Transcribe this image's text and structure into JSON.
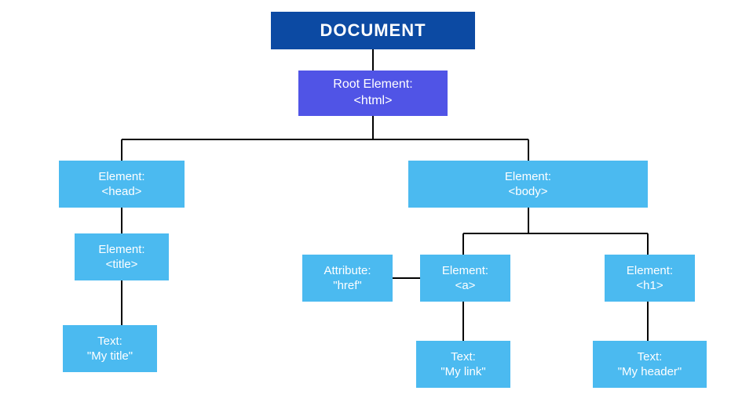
{
  "nodes": {
    "document": {
      "line1": "DOCUMENT",
      "line2": ""
    },
    "root": {
      "line1": "Root Element:",
      "line2": "<html>"
    },
    "head": {
      "line1": "Element:",
      "line2": "<head>"
    },
    "body": {
      "line1": "Element:",
      "line2": "<body>"
    },
    "title": {
      "line1": "Element:",
      "line2": "<title>"
    },
    "attrHref": {
      "line1": "Attribute:",
      "line2": "\"href\""
    },
    "a": {
      "line1": "Element:",
      "line2": "<a>"
    },
    "h1": {
      "line1": "Element:",
      "line2": "<h1>"
    },
    "textTitle": {
      "line1": "Text:",
      "line2": "\"My title\""
    },
    "textLink": {
      "line1": "Text:",
      "line2": "\"My link\""
    },
    "textHeader": {
      "line1": "Text:",
      "line2": "\"My header\""
    }
  },
  "colors": {
    "documentBg": "#0c4aa3",
    "rootBg": "#5054e6",
    "elementBg": "#4bbaf0",
    "connector": "#000000"
  }
}
